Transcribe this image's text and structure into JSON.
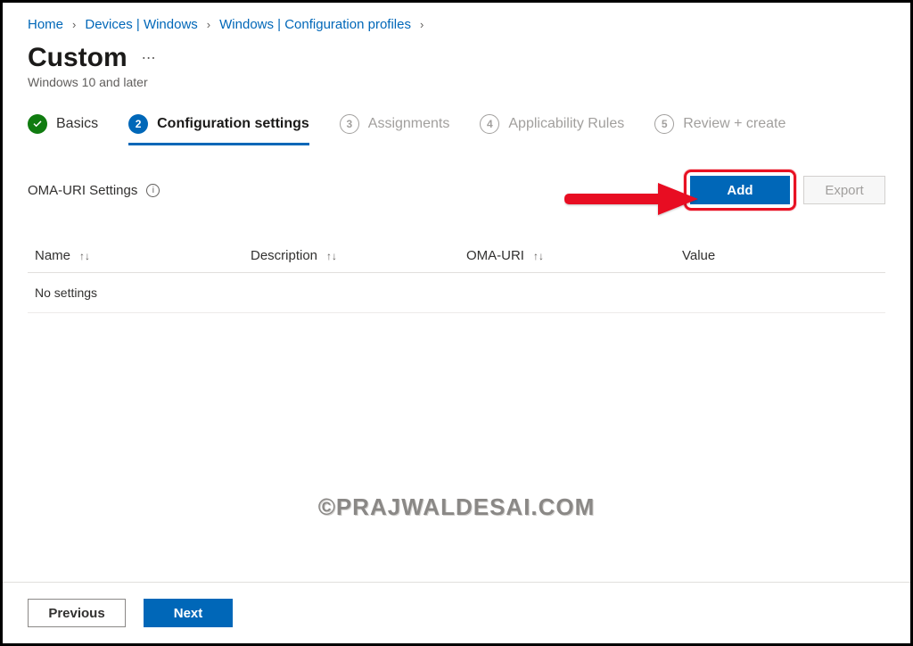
{
  "breadcrumb": [
    {
      "label": "Home"
    },
    {
      "label": "Devices | Windows"
    },
    {
      "label": "Windows | Configuration profiles"
    }
  ],
  "page": {
    "title": "Custom",
    "subtitle": "Windows 10 and later"
  },
  "steps": [
    {
      "label": "Basics",
      "state": "done"
    },
    {
      "num": "2",
      "label": "Configuration settings",
      "state": "active"
    },
    {
      "num": "3",
      "label": "Assignments",
      "state": "pending"
    },
    {
      "num": "4",
      "label": "Applicability Rules",
      "state": "pending"
    },
    {
      "num": "5",
      "label": "Review + create",
      "state": "pending"
    }
  ],
  "section": {
    "heading": "OMA-URI Settings",
    "add_label": "Add",
    "export_label": "Export"
  },
  "table": {
    "columns": [
      "Name",
      "Description",
      "OMA-URI",
      "Value"
    ],
    "empty_text": "No settings"
  },
  "footer": {
    "previous": "Previous",
    "next": "Next"
  },
  "watermark": "©PRAJWALDESAI.COM"
}
